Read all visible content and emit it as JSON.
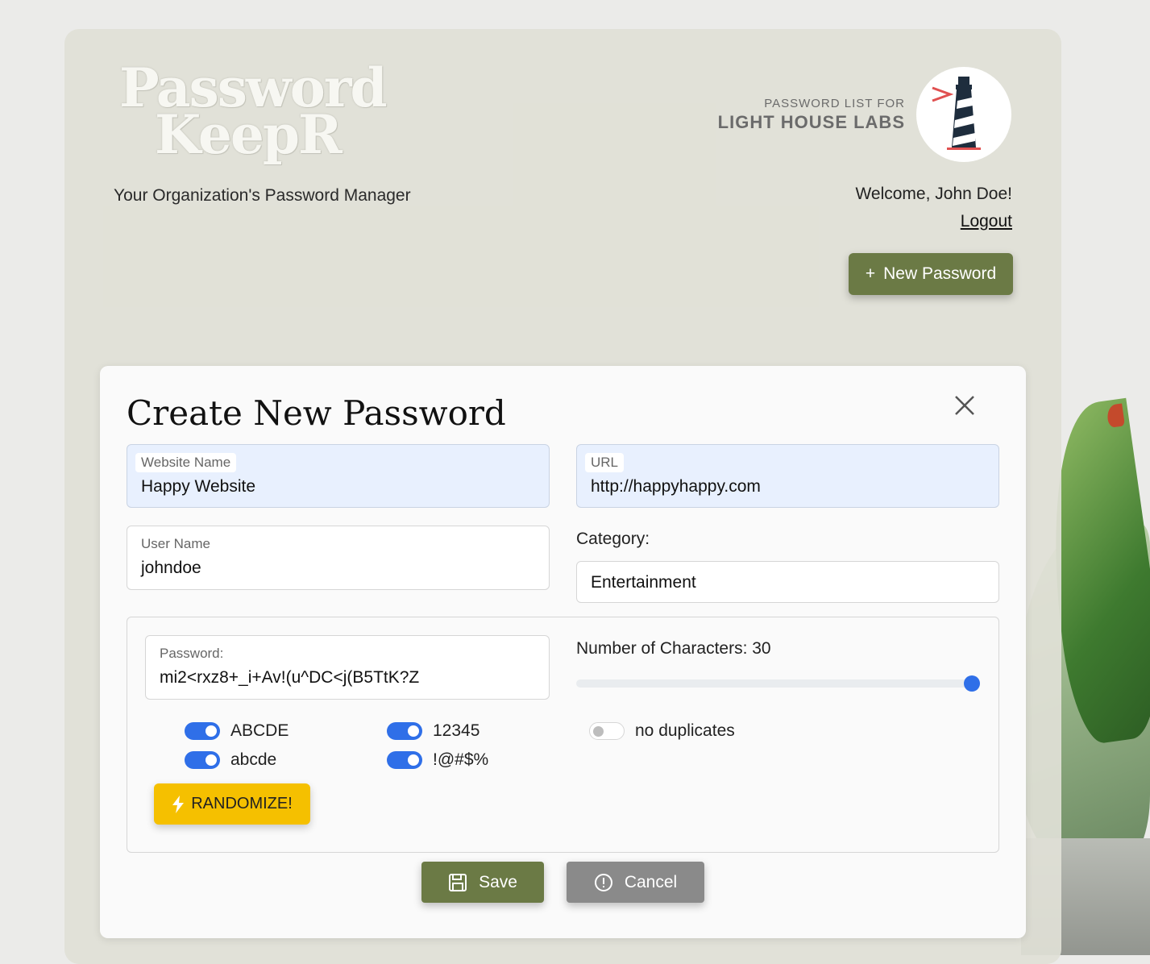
{
  "header": {
    "logo_line1": "Password",
    "logo_line2": "KeepR",
    "tagline": "Your Organization's Password Manager",
    "org_small": "PASSWORD LIST FOR",
    "org_big": "LIGHT HOUSE LABS",
    "welcome": "Welcome, John Doe!",
    "logout": "Logout",
    "new_password_label": "New Password",
    "new_password_icon": "plus-icon"
  },
  "modal": {
    "title": "Create New Password",
    "close_icon": "close-icon",
    "website": {
      "label": "Website Name",
      "value": "Happy Website"
    },
    "url": {
      "label": "URL",
      "value": "http://happyhappy.com"
    },
    "username": {
      "label": "User Name",
      "value": "johndoe"
    },
    "category": {
      "label": "Category:",
      "value": "Entertainment"
    },
    "password": {
      "label": "Password:",
      "value": "mi2<rxz8+_i+Av!(u^DC<j(B5TtK?Z"
    },
    "length": {
      "label": "Number of Characters: 30",
      "value": 30,
      "fraction": 1.0
    },
    "toggles": {
      "uppercase": {
        "label": "ABCDE",
        "on": true
      },
      "lowercase": {
        "label": "abcde",
        "on": true
      },
      "numbers": {
        "label": "12345",
        "on": true
      },
      "symbols": {
        "label": "!@#$%",
        "on": true
      },
      "no_duplicates": {
        "label": "no duplicates",
        "on": false
      }
    },
    "randomize_label": "RANDOMIZE!",
    "save_label": "Save",
    "cancel_label": "Cancel"
  },
  "colors": {
    "primary": "#6b7a45",
    "accent": "#2f6fe8",
    "randomize": "#f5c000",
    "cancel": "#8a8a8a"
  }
}
